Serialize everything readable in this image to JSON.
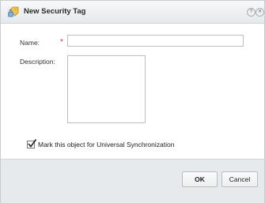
{
  "dialog": {
    "title": "New Security Tag",
    "title_icon": "security-tag-icon",
    "help_button_icon": "help-icon",
    "help_button_glyph": "?",
    "close_button_icon": "close-icon",
    "close_button_glyph": "✕"
  },
  "form": {
    "name_label": "Name:",
    "required_marker": "*",
    "name_value": "",
    "description_label": "Description:",
    "description_value": ""
  },
  "universal_sync": {
    "label": "Mark this object for Universal Synchronization",
    "checked": true
  },
  "footer": {
    "ok_label": "OK",
    "cancel_label": "Cancel"
  },
  "colors": {
    "required_marker": "#d9342b",
    "footer_background": "#e7eaed",
    "title_bar_background": "#eef0f2"
  }
}
